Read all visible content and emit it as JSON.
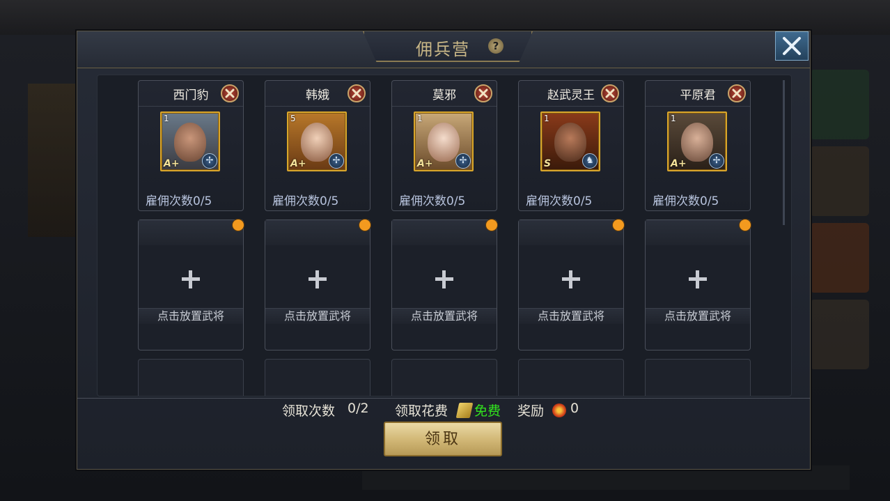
{
  "dialog": {
    "title": "佣兵营",
    "help_glyph": "?"
  },
  "heroes": [
    {
      "name": "西门豹",
      "level": "1",
      "rank": "A+",
      "unit_icon": "crossbow-icon",
      "hire_count": "雇佣次数0/5"
    },
    {
      "name": "韩娥",
      "level": "5",
      "rank": "A+",
      "unit_icon": "crossbow-icon",
      "hire_count": "雇佣次数0/5"
    },
    {
      "name": "莫邪",
      "level": "1",
      "rank": "A+",
      "unit_icon": "crossbow-icon",
      "hire_count": "雇佣次数0/5"
    },
    {
      "name": "赵武灵王",
      "level": "1",
      "rank": "S",
      "unit_icon": "cavalry-icon",
      "hire_count": "雇佣次数0/5"
    },
    {
      "name": "平原君",
      "level": "1",
      "rank": "A+",
      "unit_icon": "crossbow-icon",
      "hire_count": "雇佣次数0/5"
    }
  ],
  "slots": [
    {
      "label": "点击放置武将"
    },
    {
      "label": "点击放置武将"
    },
    {
      "label": "点击放置武将"
    },
    {
      "label": "点击放置武将"
    },
    {
      "label": "点击放置武将"
    }
  ],
  "footer": {
    "claim_count_label": "领取次数",
    "claim_count_value": "0/2",
    "cost_label": "领取花费",
    "cost_value": "免费",
    "reward_label": "奖励",
    "reward_value": "0",
    "claim_button": "领取"
  },
  "colors": {
    "accent_gold": "#d9a62c",
    "free_green": "#32e51e",
    "notify_orange": "#f39a1f"
  }
}
